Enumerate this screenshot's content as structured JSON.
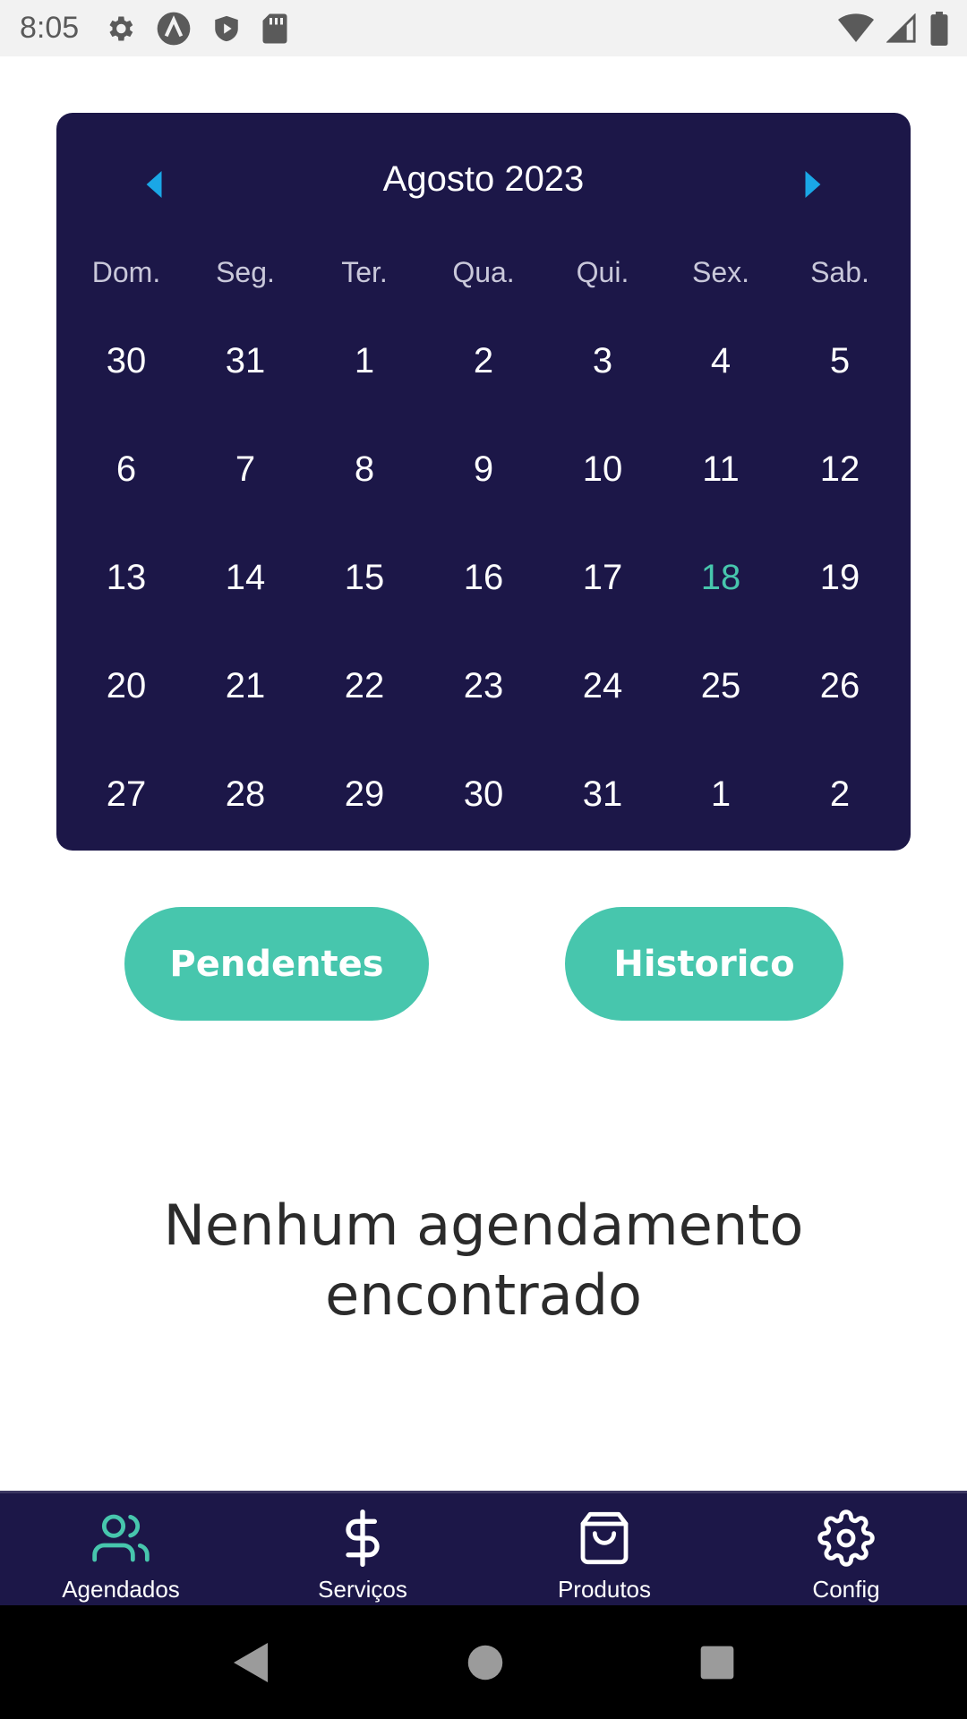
{
  "status_bar": {
    "time": "8:05",
    "icons_left": [
      "gear-icon",
      "a-icon",
      "shield-play-icon",
      "sd-card-icon"
    ],
    "icons_right": [
      "wifi-icon",
      "signal-icon",
      "battery-icon"
    ]
  },
  "calendar": {
    "month_label": "Agosto 2023",
    "weekdays": [
      "Dom.",
      "Seg.",
      "Ter.",
      "Qua.",
      "Qui.",
      "Sex.",
      "Sab."
    ],
    "weeks": [
      [
        "30",
        "31",
        "1",
        "2",
        "3",
        "4",
        "5"
      ],
      [
        "6",
        "7",
        "8",
        "9",
        "10",
        "11",
        "12"
      ],
      [
        "13",
        "14",
        "15",
        "16",
        "17",
        "18",
        "19"
      ],
      [
        "20",
        "21",
        "22",
        "23",
        "24",
        "25",
        "26"
      ],
      [
        "27",
        "28",
        "29",
        "30",
        "31",
        "1",
        "2"
      ]
    ],
    "today": "18",
    "accent_color": "#47c6ad",
    "arrow_color": "#1aa7e6",
    "background_color": "#1c1748"
  },
  "buttons": {
    "pendentes": "Pendentes",
    "historico": "Historico"
  },
  "empty_state": {
    "line1": "Nenhum agendamento",
    "line2": "encontrado"
  },
  "bottom_nav": {
    "items": [
      {
        "label": "Agendados",
        "icon": "users-icon",
        "active": true
      },
      {
        "label": "Serviços",
        "icon": "dollar-icon",
        "active": false
      },
      {
        "label": "Produtos",
        "icon": "shopping-bag-icon",
        "active": false
      },
      {
        "label": "Config",
        "icon": "gear-icon",
        "active": false
      }
    ]
  }
}
